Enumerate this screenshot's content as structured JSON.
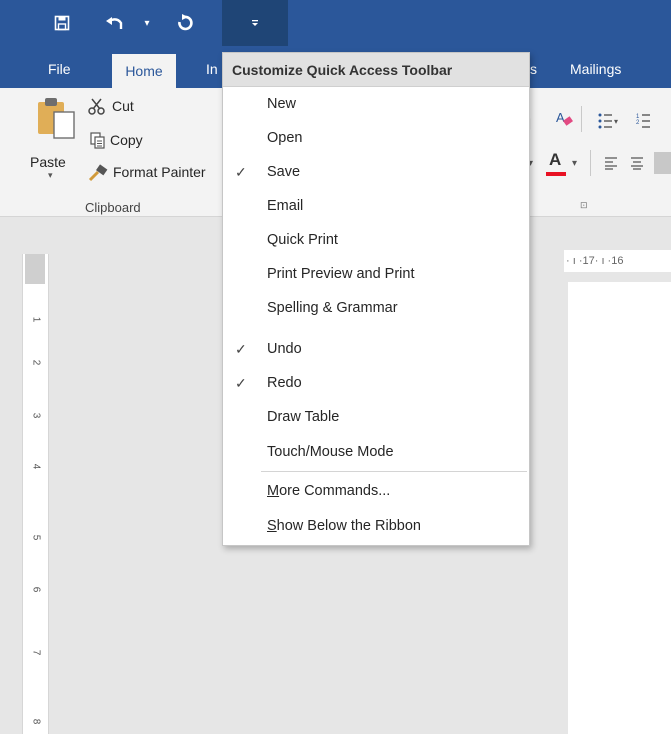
{
  "quick_access": {
    "save_icon": "save-icon",
    "undo_icon": "undo-icon",
    "undo_dropdown_icon": "chevron-down-icon",
    "redo_icon": "redo-icon",
    "customize_icon": "customize-qat-icon"
  },
  "tabs": [
    {
      "label": "File"
    },
    {
      "label": "Home"
    },
    {
      "label": "In"
    },
    {
      "label": "s"
    },
    {
      "label": "Mailings"
    }
  ],
  "ribbon": {
    "clipboard": {
      "paste_label": "Paste",
      "cut_label": "Cut",
      "copy_label": "Copy",
      "format_painter_label": "Format Painter",
      "group_label": "Clipboard"
    }
  },
  "ruler": {
    "horizontal_text": "· ı ·17· ı ·16",
    "vertical_numbers": [
      "1",
      "2",
      "3",
      "4",
      "5",
      "6",
      "7",
      "8"
    ]
  },
  "menu": {
    "title": "Customize Quick Access Toolbar",
    "items": [
      {
        "label": "New",
        "checked": false
      },
      {
        "label": "Open",
        "checked": false
      },
      {
        "label": "Save",
        "checked": true
      },
      {
        "label": "Email",
        "checked": false
      },
      {
        "label": "Quick Print",
        "checked": false
      },
      {
        "label": "Print Preview and Print",
        "checked": false
      },
      {
        "label": "Spelling & Grammar",
        "checked": false
      },
      {
        "label": "Undo",
        "checked": true
      },
      {
        "label": "Redo",
        "checked": true
      },
      {
        "label": "Draw Table",
        "checked": false
      },
      {
        "label": "Touch/Mouse Mode",
        "checked": false
      }
    ],
    "more_commands_label": "More Commands...",
    "show_below_label": "Show Below the Ribbon"
  },
  "colors": {
    "title_bar": "#2b579a",
    "ribbon": "#f3f3f3",
    "font_color_accent": "#e81123"
  }
}
